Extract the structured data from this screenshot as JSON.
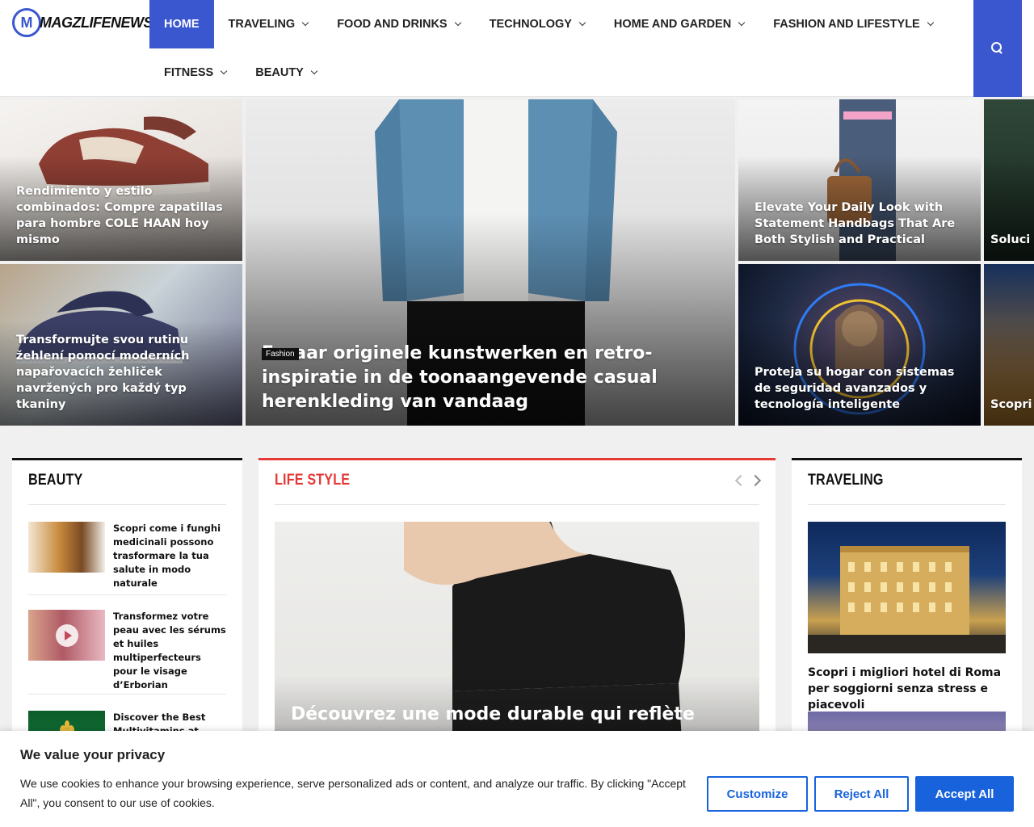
{
  "site": {
    "logo_letter": "M",
    "logo_text": "MAGZLIFENEWS"
  },
  "nav": {
    "row1": [
      {
        "label": "HOME",
        "active": true,
        "dropdown": false
      },
      {
        "label": "TRAVELING",
        "active": false,
        "dropdown": true
      },
      {
        "label": "FOOD AND DRINKS",
        "active": false,
        "dropdown": true
      },
      {
        "label": "TECHNOLOGY",
        "active": false,
        "dropdown": true
      },
      {
        "label": "HOME AND GARDEN",
        "active": false,
        "dropdown": true
      },
      {
        "label": "FASHION AND LIFESTYLE",
        "active": false,
        "dropdown": true
      }
    ],
    "row2": [
      {
        "label": "FITNESS",
        "active": false,
        "dropdown": true
      },
      {
        "label": "BEAUTY",
        "active": false,
        "dropdown": true
      }
    ],
    "search_icon": "search-icon",
    "accent_color": "#3b57d0"
  },
  "hero": {
    "tile1": {
      "title": "Rendimiento y estilo combinados: Compre zapatillas para hombre COLE HAAN hoy mismo"
    },
    "tile2": {
      "title": "Transformujte svou rutinu žehlení pomocí moderních napařovacích žehliček navržených pro každý typ tkaniny"
    },
    "featured": {
      "category": "Fashion",
      "title": "Ervaar originele kunstwerken en retro-inspiratie in de toonaangevende casual herenkleding van vandaag"
    },
    "tile4": {
      "title": "Elevate Your Daily Look with Statement Handbags That Are Both Stylish and Practical"
    },
    "tile5": {
      "title": "Proteja su hogar con sistemas de seguridad avanzados y tecnología inteligente"
    },
    "tile6": {
      "title": "Soluci fiables"
    },
    "tile7": {
      "title": "Scopri soggi"
    }
  },
  "beauty": {
    "heading": "BEAUTY",
    "items": [
      {
        "title": "Scopri come i funghi medicinali possono trasformare la tua salute in modo naturale"
      },
      {
        "title": "Transformez votre peau avec les sérums et huiles multiperfecteurs pour le visage d’Erborian"
      },
      {
        "title": "Discover the Best Multivitamins at"
      }
    ]
  },
  "lifestyle": {
    "heading": "LIFE STYLE",
    "accent_color": "#e53935",
    "featured_title": "Découvrez une mode durable qui reflète votre"
  },
  "traveling": {
    "heading": "TRAVELING",
    "featured_title": "Scopri i migliori hotel di Roma per soggiorni senza stress e piacevoli"
  },
  "cookie": {
    "title": "We value your privacy",
    "text": "We use cookies to enhance your browsing experience, serve personalized ads or content, and analyze our traffic. By clicking \"Accept All\", you consent to our use of cookies.",
    "customize": "Customize",
    "reject": "Reject All",
    "accept": "Accept All",
    "button_color": "#1863dc"
  }
}
